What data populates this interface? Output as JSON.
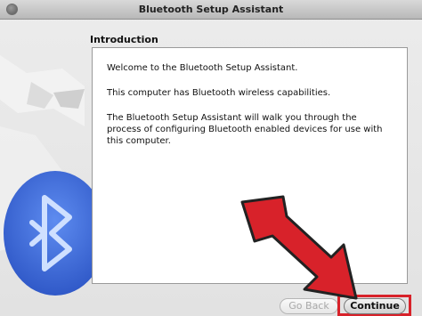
{
  "window": {
    "title": "Bluetooth Setup Assistant"
  },
  "section": {
    "heading": "Introduction"
  },
  "content": {
    "paragraph_1": "Welcome to the Bluetooth Setup Assistant.",
    "paragraph_2": "This computer has Bluetooth wireless capabilities.",
    "paragraph_3": "The Bluetooth Setup Assistant will walk you through the process of configuring Bluetooth enabled devices for use with this computer."
  },
  "buttons": {
    "back_label": "Go Back",
    "back_enabled": false,
    "continue_label": "Continue"
  },
  "icons": {
    "decorative": "bluetooth-icon",
    "annotation": "red-arrow-icon"
  },
  "colors": {
    "annotation_red": "#d8222a",
    "bluetooth_blue": "#3d6fe0"
  }
}
